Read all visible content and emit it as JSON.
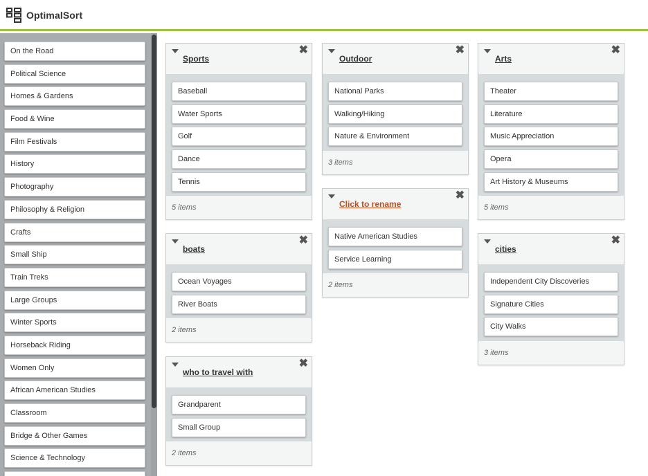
{
  "app": {
    "name": "OptimalSort"
  },
  "sidebar": {
    "cards": [
      "On the Road",
      "Political Science",
      "Homes & Gardens",
      "Food & Wine",
      "Film Festivals",
      "History",
      "Photography",
      "Philosophy & Religion",
      "Crafts",
      "Small Ship",
      "Train Treks",
      "Large Groups",
      "Winter Sports",
      "Horseback Riding",
      "Women Only",
      "African American Studies",
      "Classroom",
      "Bridge & Other Games",
      "Science & Technology",
      ""
    ]
  },
  "groups": [
    {
      "title": "Sports",
      "items": [
        "Baseball",
        "Water Sports",
        "Golf",
        "Dance",
        "Tennis"
      ],
      "count": "5 items"
    },
    {
      "title": "boats",
      "items": [
        "Ocean Voyages",
        "River Boats"
      ],
      "count": "2 items"
    },
    {
      "title": "who to travel with",
      "items": [
        "Grandparent",
        "Small Group"
      ],
      "count": "2 items"
    },
    {
      "title": "Outdoor",
      "items": [
        "National Parks",
        "Walking/Hiking",
        "Nature & Environment"
      ],
      "count": "3 items"
    },
    {
      "title": "Click to rename",
      "items": [
        "Native American Studies",
        "Service Learning"
      ],
      "count": "2 items"
    },
    {
      "title": "Arts",
      "items": [
        "Theater",
        "Literature",
        "Music Appreciation",
        "Opera",
        "Art History & Museums"
      ],
      "count": "5 items"
    },
    {
      "title": "cities",
      "items": [
        "Independent City Discoveries",
        "Signature Cities",
        "City Walks"
      ],
      "count": "3 items"
    }
  ],
  "colors": {
    "accent_bar": "#9bc53d",
    "rename_link": "#c0501e"
  }
}
